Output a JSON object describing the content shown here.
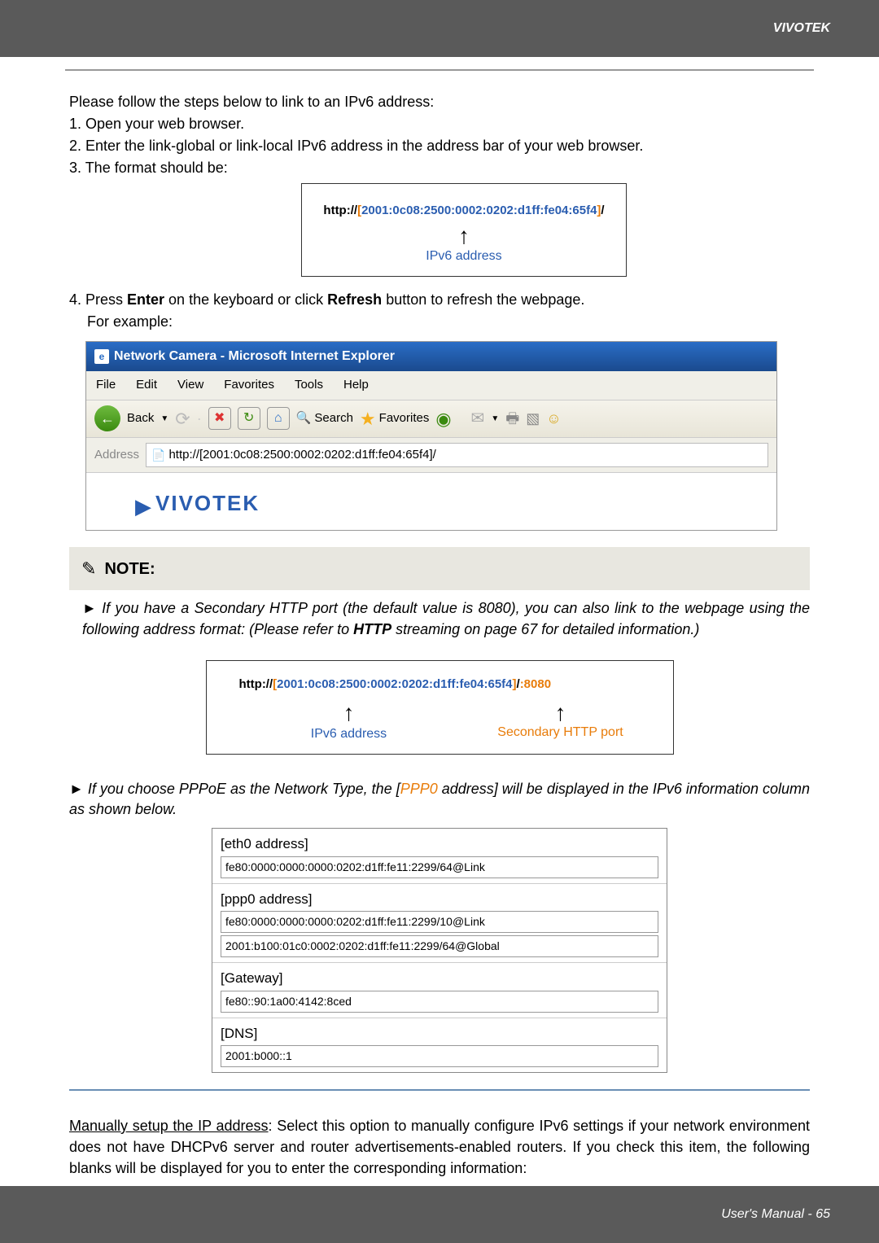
{
  "header": {
    "brand": "VIVOTEK"
  },
  "intro": {
    "lead": "Please follow the steps below to link to an IPv6 address:",
    "step1": "1. Open your web browser.",
    "step2": "2. Enter the link-global or link-local IPv6 address in the address bar of your web browser.",
    "step3": "3. The format should be:"
  },
  "url1": {
    "http": "http://",
    "open": "[",
    "addr": "2001:0c08:2500:0002:0202:d1ff:fe04:65f4",
    "close": "]",
    "tail": "/",
    "label": "IPv6 address"
  },
  "step4": {
    "prefix": "4. Press ",
    "enter": "Enter",
    "mid": " on the keyboard or click ",
    "refresh": "Refresh",
    "suffix": " button to refresh the webpage.",
    "example": "For example:"
  },
  "ie": {
    "title": "Network Camera - Microsoft Internet Explorer",
    "menu": {
      "file": "File",
      "edit": "Edit",
      "view": "View",
      "favorites": "Favorites",
      "tools": "Tools",
      "help": "Help"
    },
    "toolbar": {
      "back": "Back",
      "search": "Search",
      "favorites": "Favorites"
    },
    "addrLabel": "Address",
    "addrValue": "http://[2001:0c08:2500:0002:0202:d1ff:fe04:65f4]/",
    "logo": "VIVOTEK"
  },
  "note": {
    "heading": "NOTE:",
    "item1_a": "If you have a Secondary HTTP port (the default value is 8080), you can also link to the webpage using the following address format: (Please refer to ",
    "item1_b": "HTTP",
    "item1_c": " streaming on page 67 for detailed information.)"
  },
  "url2": {
    "http": "http://",
    "open": "[",
    "addr": "2001:0c08:2500:0002:0202:d1ff:fe04:65f4",
    "close": "]",
    "slash": "/",
    "port": ":8080",
    "ipv6label": "IPv6 address",
    "portlabel": "Secondary HTTP port"
  },
  "note2": {
    "a": "If you choose PPPoE as the Network Type, the [",
    "b": "PPP0",
    "c": " address] will be displayed in the IPv6 information column as shown below."
  },
  "pppoe": {
    "eth0_label": "[eth0 address]",
    "eth0_val": "fe80:0000:0000:0000:0202:d1ff:fe11:2299/64@Link",
    "ppp0_label": "[ppp0 address]",
    "ppp0_val1": "fe80:0000:0000:0000:0202:d1ff:fe11:2299/10@Link",
    "ppp0_val2": "2001:b100:01c0:0002:0202:d1ff:fe11:2299/64@Global",
    "gw_label": "[Gateway]",
    "gw_val": "fe80::90:1a00:4142:8ced",
    "dns_label": "[DNS]",
    "dns_val": "2001:b000::1"
  },
  "manual": {
    "title": "Manually setup the IP address",
    "body": ": Select this option to manually configure IPv6 settings if your network environment does not have DHCPv6 server and router advertisements-enabled routers. If you check this item, the following blanks will be displayed for you to enter the corresponding information:"
  },
  "footer": {
    "text": "User's Manual - 65"
  }
}
